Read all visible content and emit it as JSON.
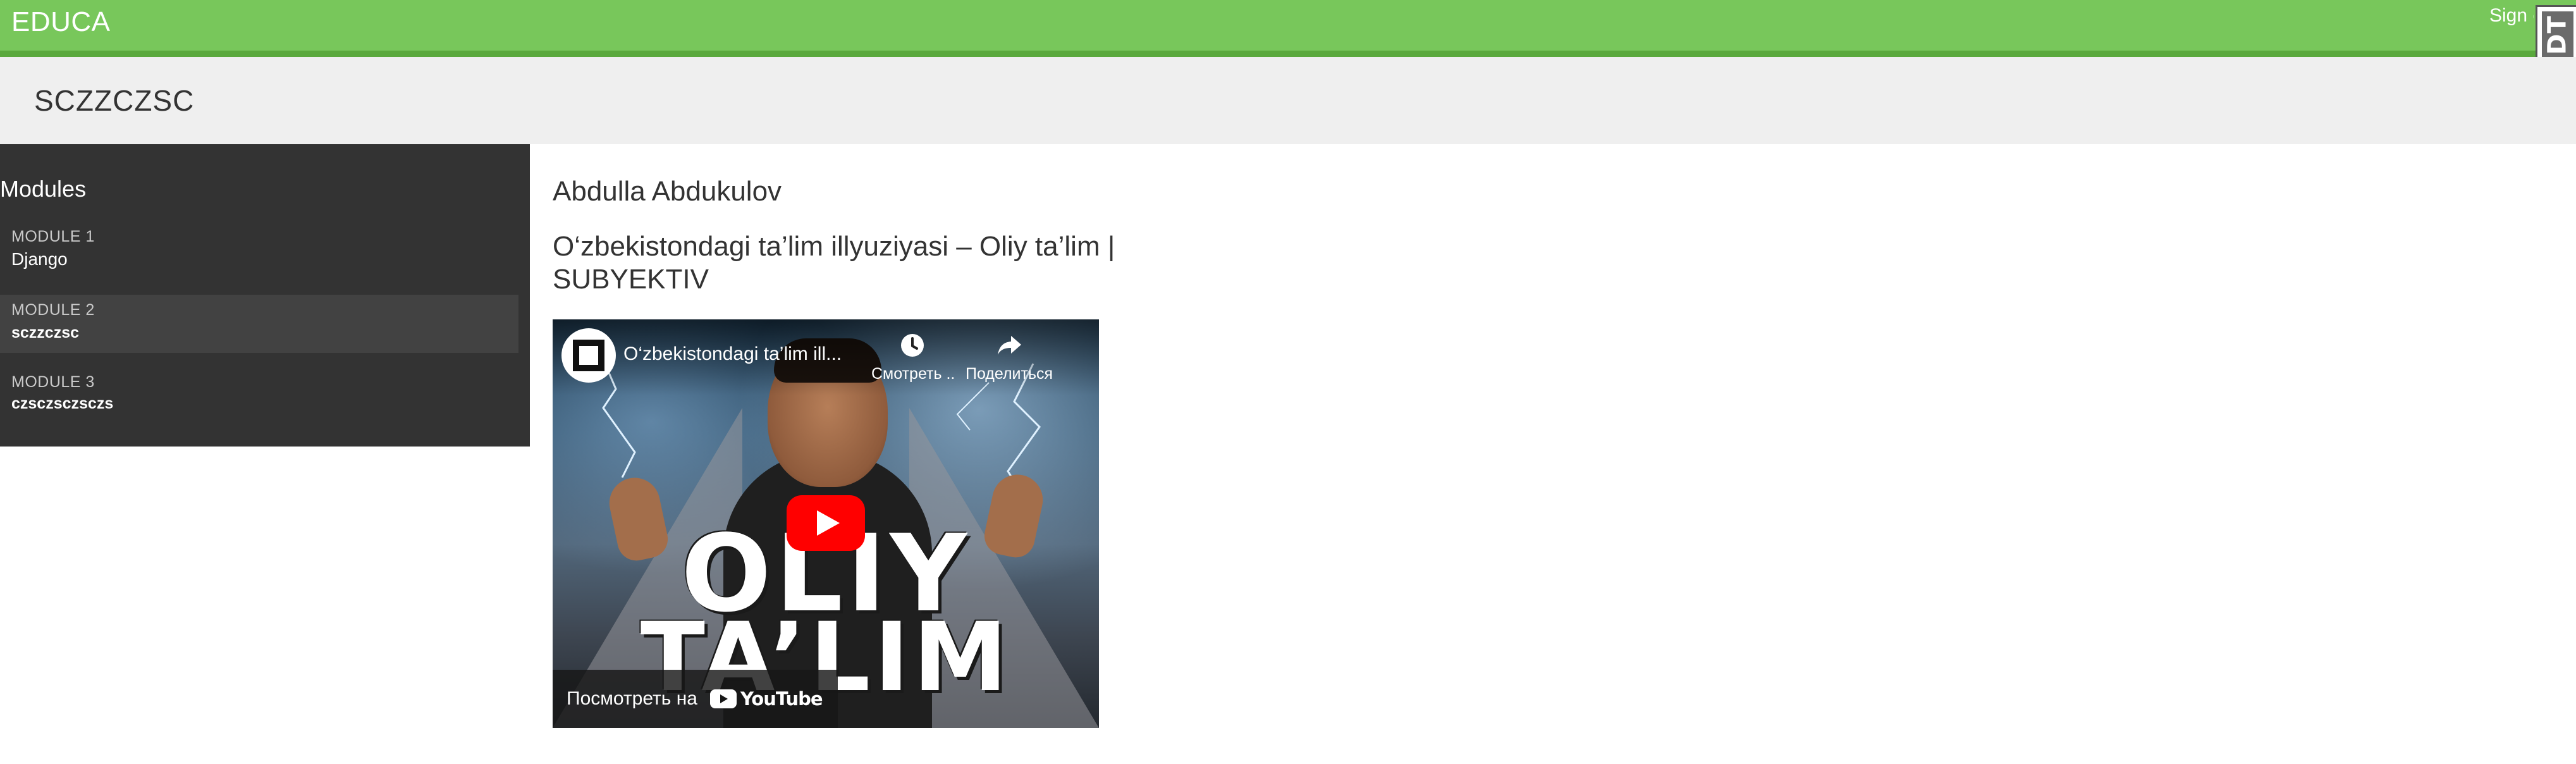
{
  "header": {
    "logo": "EDUCA",
    "signout_label": "Sign out"
  },
  "debug_toolbar": {
    "handle_label": "DjDT"
  },
  "course": {
    "title": "SCZZCZSC"
  },
  "sidebar": {
    "heading": "Modules",
    "modules": [
      {
        "number": "MODULE 1",
        "name": "Django",
        "selected": false
      },
      {
        "number": "MODULE 2",
        "name": "sczzczsc",
        "selected": true
      },
      {
        "number": "MODULE 3",
        "name": "czsczsczsczs",
        "selected": false
      }
    ]
  },
  "content": {
    "author": "Abdulla Abdukulov",
    "title": "O‘zbekistondagi ta’lim illyuziyasi – Oliy ta’lim | SUBYEKTIV"
  },
  "video": {
    "title": "O‘zbekistondagi ta’lim ill...",
    "watch_later_label": "Смотреть ...",
    "share_label": "Поделиться",
    "watch_on_label": "Посмотреть на",
    "platform": "YouTube",
    "thumbnail_text_1": "OLIY",
    "thumbnail_text_2": "TA’LIM",
    "colors": {
      "play_button": "#ff0000"
    }
  },
  "colors": {
    "header_bg": "#78c75b",
    "header_border": "#5aa93d",
    "sidebar_bg": "#333333",
    "sidebar_selected_bg": "#424242",
    "titlebar_bg": "#efefef"
  }
}
